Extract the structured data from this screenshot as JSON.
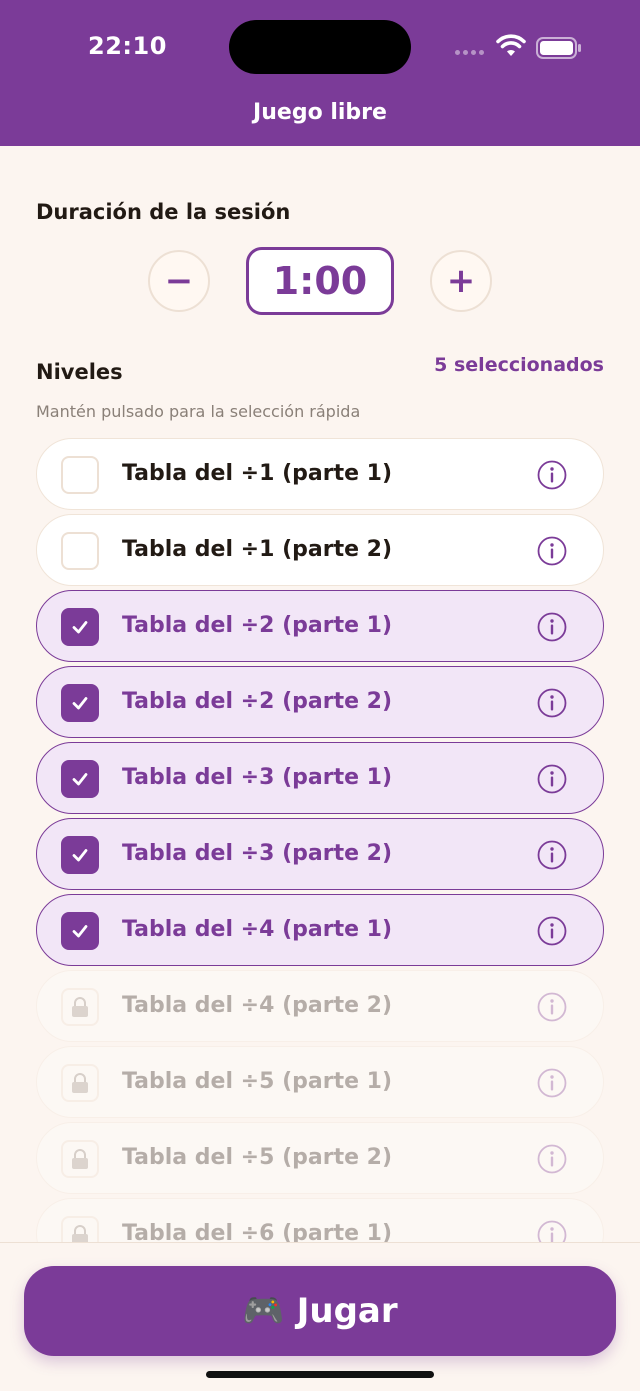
{
  "status_bar": {
    "time": "22:10"
  },
  "nav": {
    "title": "Juego libre"
  },
  "session": {
    "title": "Duración de la sesión",
    "value": "1:00",
    "minus": "−",
    "plus": "+"
  },
  "levels": {
    "title": "Niveles",
    "selected_count": "5 seleccionados",
    "hint": "Mantén pulsado para la selección rápida",
    "items": [
      {
        "label": "Tabla del ÷1 (parte 1)",
        "state": "unchecked"
      },
      {
        "label": "Tabla del ÷1 (parte 2)",
        "state": "unchecked"
      },
      {
        "label": "Tabla del ÷2 (parte 1)",
        "state": "checked"
      },
      {
        "label": "Tabla del ÷2 (parte 2)",
        "state": "checked"
      },
      {
        "label": "Tabla del ÷3 (parte 1)",
        "state": "checked"
      },
      {
        "label": "Tabla del ÷3 (parte 2)",
        "state": "checked"
      },
      {
        "label": "Tabla del ÷4 (parte 1)",
        "state": "checked"
      },
      {
        "label": "Tabla del ÷4 (parte 2)",
        "state": "locked"
      },
      {
        "label": "Tabla del ÷5 (parte 1)",
        "state": "locked"
      },
      {
        "label": "Tabla del ÷5 (parte 2)",
        "state": "locked"
      },
      {
        "label": "Tabla del ÷6 (parte 1)",
        "state": "locked"
      }
    ]
  },
  "play": {
    "emoji": "🎮",
    "label": "Jugar"
  },
  "colors": {
    "accent": "#7b3b98",
    "background": "#fcf5f0"
  }
}
